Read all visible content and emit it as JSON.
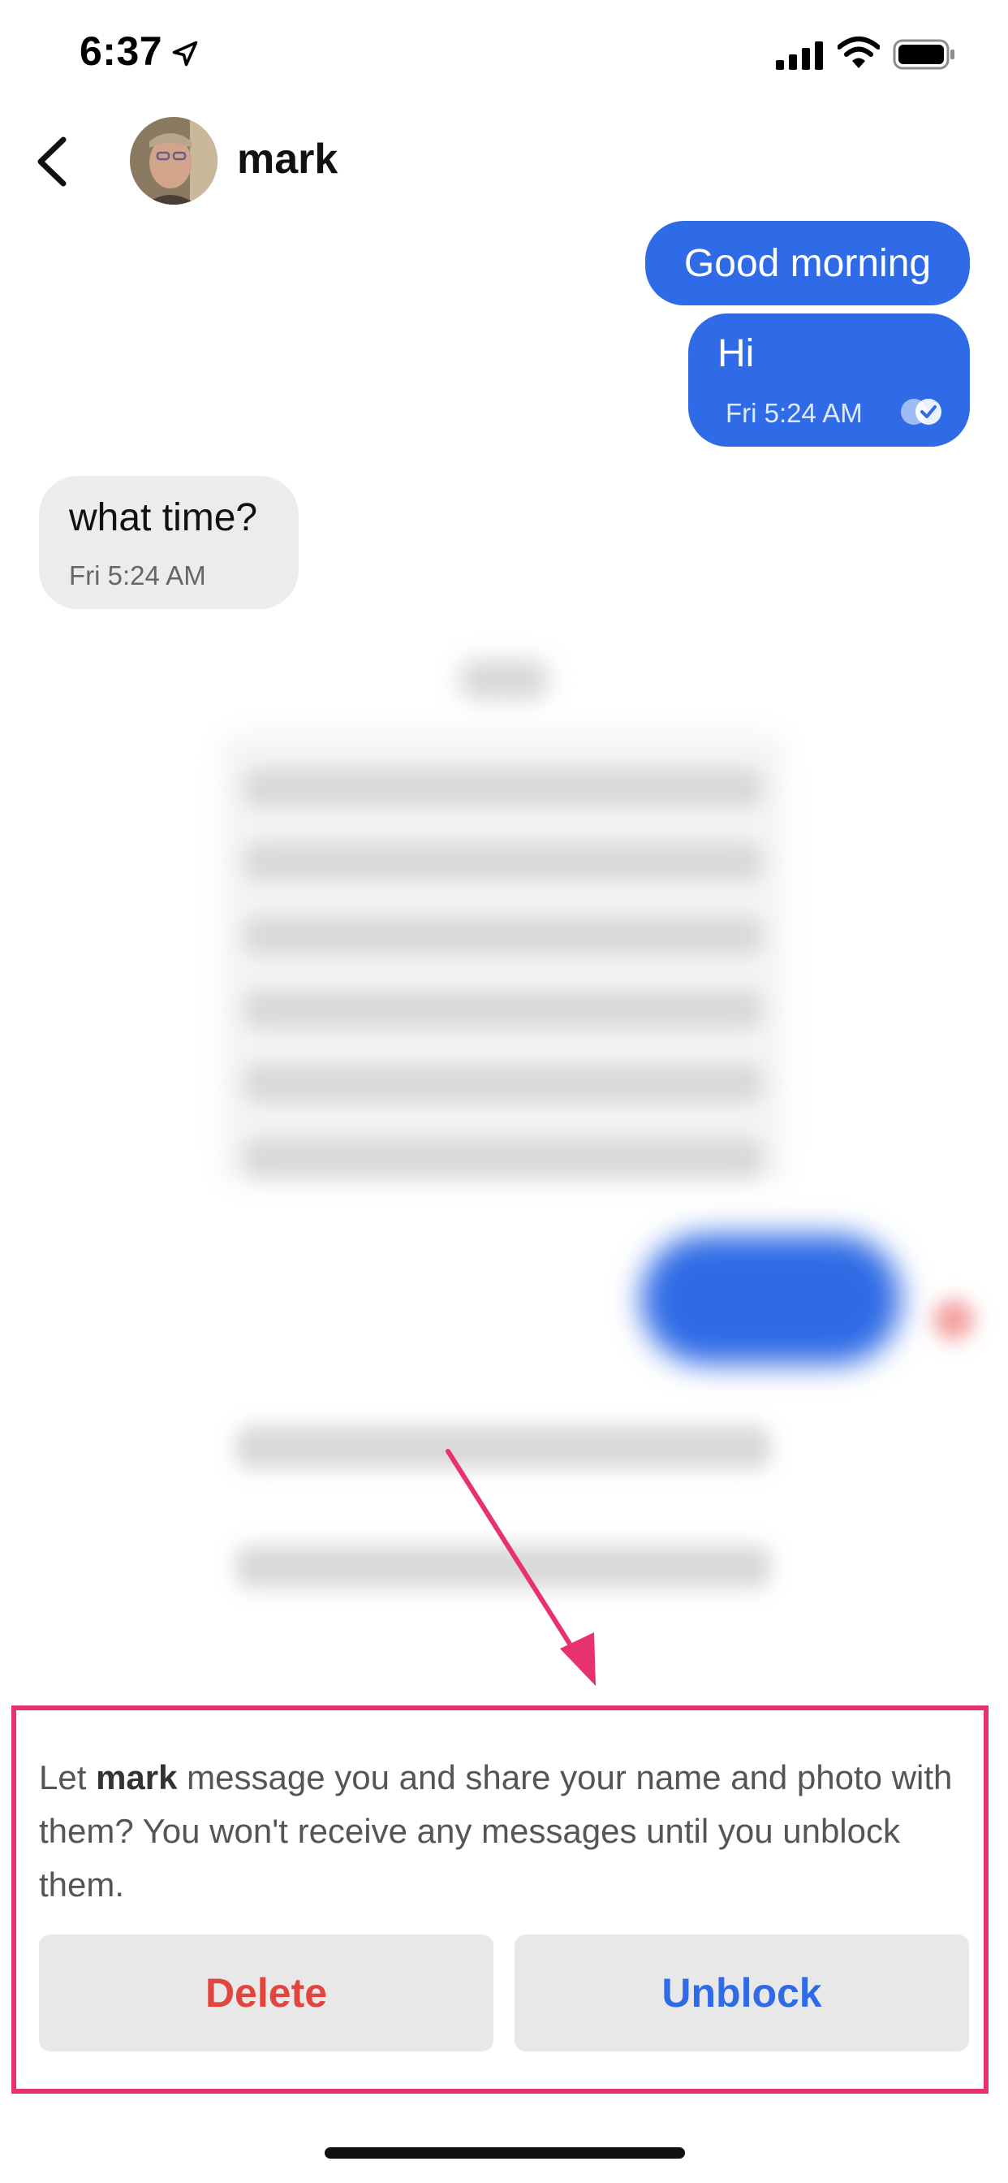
{
  "status_bar": {
    "time": "6:37",
    "icons": [
      "location-arrow-icon",
      "cellular-signal-icon",
      "wifi-icon",
      "battery-icon"
    ]
  },
  "header": {
    "contact_name": "mark",
    "back_icon": "chevron-left-icon"
  },
  "messages": [
    {
      "direction": "outgoing",
      "text": "Good morning"
    },
    {
      "direction": "outgoing",
      "text": "Hi",
      "time": "Fri 5:24 AM",
      "status_icon": "read-check-icon"
    },
    {
      "direction": "incoming",
      "text": "what time?",
      "time": "Fri 5:24 AM"
    }
  ],
  "block_prompt": {
    "text_before": "Let ",
    "name": "mark",
    "text_after": " message you and share your name and photo with them? You won't receive any messages until you unblock them.",
    "delete_label": "Delete",
    "unblock_label": "Unblock"
  },
  "colors": {
    "outgoing_bubble": "#2f6be6",
    "incoming_bubble": "#ececec",
    "delete_text": "#e2453d",
    "unblock_text": "#2f6be6",
    "annotation": "#e8326e"
  }
}
